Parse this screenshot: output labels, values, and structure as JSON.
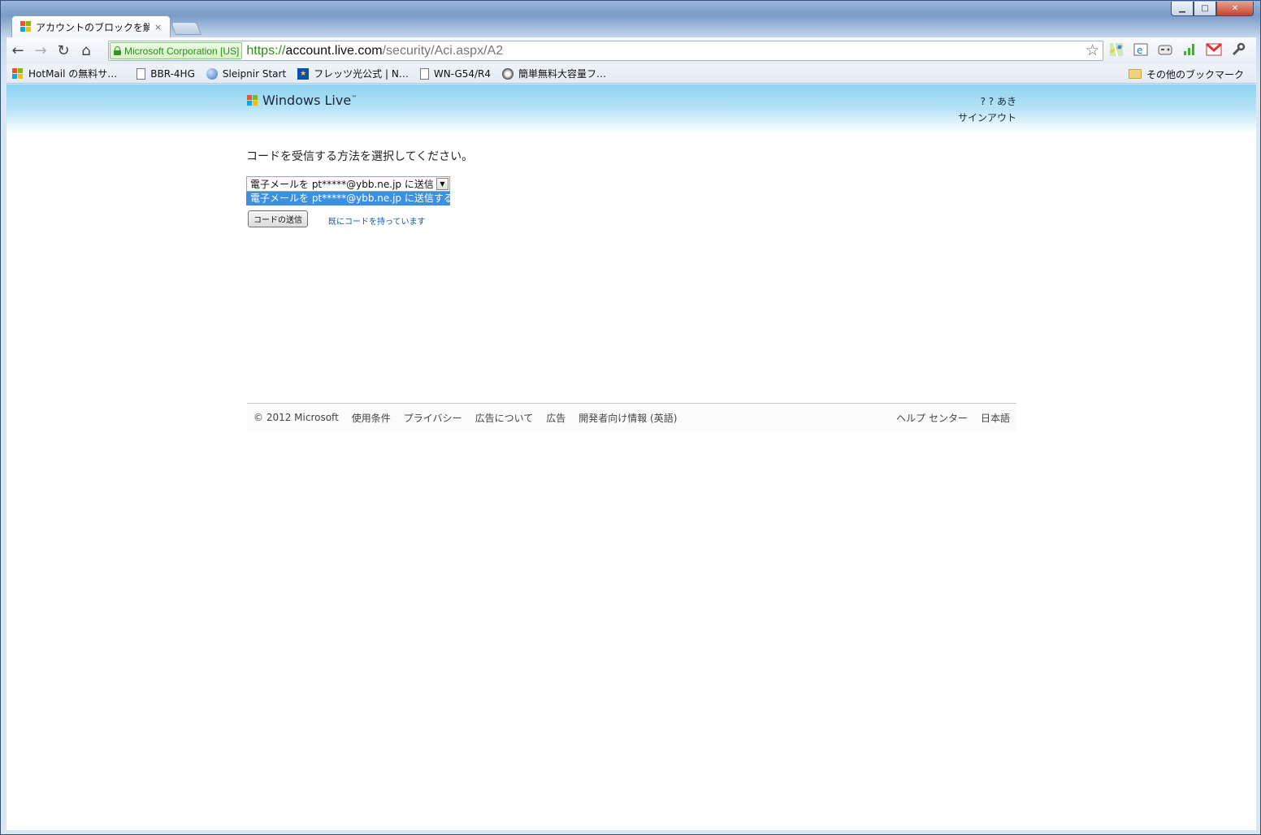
{
  "window": {
    "minimize_glyph": "▁",
    "maximize_glyph": "□",
    "close_glyph": "✕"
  },
  "tab": {
    "title": "アカウントのブロックを解除",
    "close_glyph": "×"
  },
  "toolbar": {
    "back_glyph": "←",
    "forward_glyph": "→",
    "reload_glyph": "↻",
    "home_glyph": "⌂",
    "ev_cert": "Microsoft Corporation [US]",
    "url_scheme": "https://",
    "url_host": "account.live.com",
    "url_path": "/security/Aci.aspx/A2",
    "star_glyph": "☆",
    "extensions": [
      "maps-icon",
      "ie-tab-icon",
      "gamepad-icon",
      "signal-icon",
      "gmail-icon",
      "wrench-icon"
    ]
  },
  "bookmarks": {
    "items": [
      {
        "label": "HotMail の無料サ…",
        "icon": "windows-flag-icon"
      },
      {
        "label": "BBR-4HG",
        "icon": "page-icon"
      },
      {
        "label": "Sleipnir Start",
        "icon": "globe-icon"
      },
      {
        "label": "フレッツ光公式 | N…",
        "icon": "flets-icon"
      },
      {
        "label": "WN-G54/R4",
        "icon": "page-icon"
      },
      {
        "label": "簡単無料大容量フ…",
        "icon": "ship-icon"
      }
    ],
    "other": "その他のブックマーク"
  },
  "header": {
    "logo_text": "Windows Live",
    "logo_tm": "™",
    "user_name": "? ?  あき",
    "sign_out": "サインアウト"
  },
  "main": {
    "prompt": "コードを受信する方法を選択してください。",
    "select_value": "電子メールを pt*****@ybb.ne.jp に送信する",
    "select_option": "電子メールを pt*****@ybb.ne.jp に送信する",
    "send_button": "コードの送信",
    "have_code_link": "既にコードを持っています"
  },
  "footer": {
    "links_left": [
      "© 2012 Microsoft",
      "使用条件",
      "プライバシー",
      "広告について",
      "広告",
      "開発者向け情報 (英語)"
    ],
    "links_right": [
      "ヘルプ センター",
      "日本語"
    ]
  }
}
